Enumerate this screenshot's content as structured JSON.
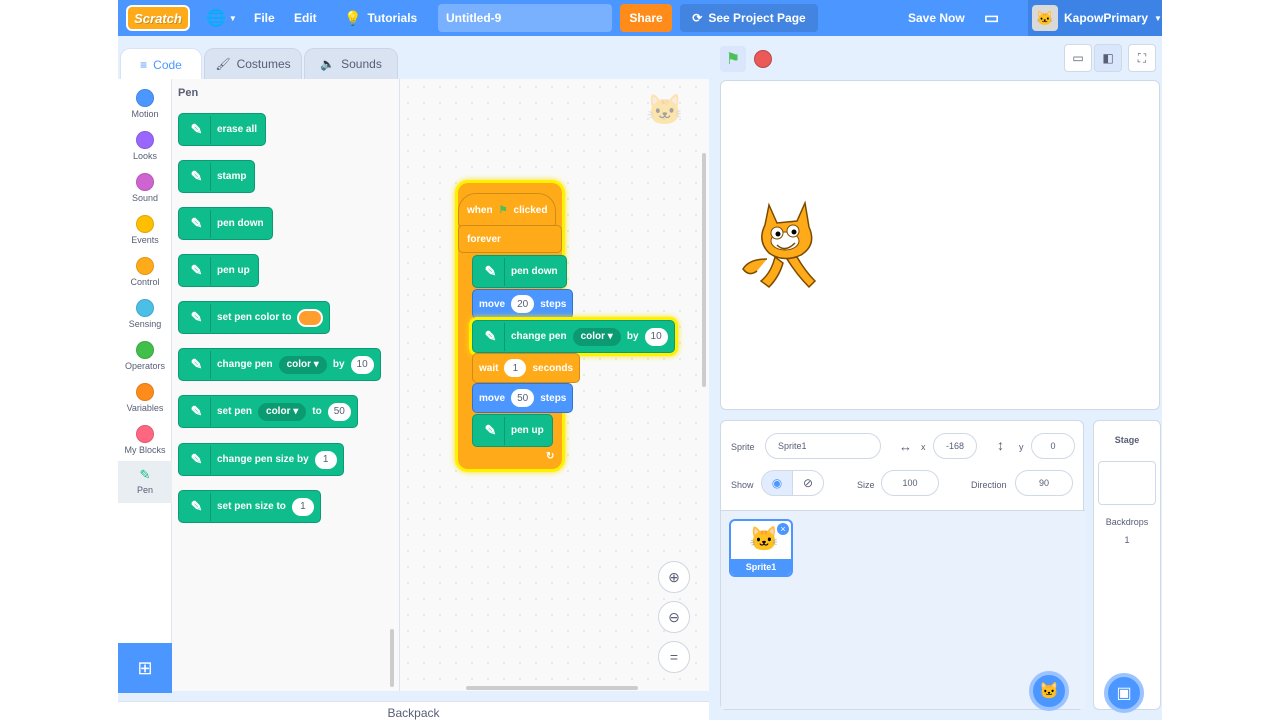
{
  "menu": {
    "logo": "Scratch",
    "globe": "globe-icon",
    "file": "File",
    "edit": "Edit",
    "tutorials": "Tutorials",
    "project_title": "Untitled-9",
    "share": "Share",
    "see_project": "See Project Page",
    "save_now": "Save Now",
    "username": "KapowPrimary"
  },
  "tabs": {
    "code": "Code",
    "costumes": "Costumes",
    "sounds": "Sounds"
  },
  "categories": [
    {
      "label": "Motion",
      "color": "#4c97ff"
    },
    {
      "label": "Looks",
      "color": "#9966ff"
    },
    {
      "label": "Sound",
      "color": "#cf63cf"
    },
    {
      "label": "Events",
      "color": "#ffbf00"
    },
    {
      "label": "Control",
      "color": "#ffab19"
    },
    {
      "label": "Sensing",
      "color": "#4cbfe6"
    },
    {
      "label": "Operators",
      "color": "#40bf4a"
    },
    {
      "label": "Variables",
      "color": "#ff8c1a"
    },
    {
      "label": "My Blocks",
      "color": "#ff6680"
    },
    {
      "label": "Pen",
      "color": "#0fbd8c"
    }
  ],
  "flyout": {
    "title": "Pen",
    "erase_all": "erase all",
    "stamp": "stamp",
    "pen_down": "pen down",
    "pen_up": "pen up",
    "set_pen_color_to": "set pen color to",
    "change_pen": "change pen",
    "color_opt": "color",
    "by": "by",
    "ten": "10",
    "set_pen": "set pen",
    "to": "to",
    "fifty": "50",
    "change_pen_size_by": "change pen size by",
    "one": "1",
    "set_pen_size_to": "set pen size to"
  },
  "script": {
    "when": "when",
    "clicked": "clicked",
    "forever": "forever",
    "pen_down": "pen down",
    "move": "move",
    "move1_val": "20",
    "steps": "steps",
    "change_pen": "change pen",
    "color_opt": "color",
    "by": "by",
    "by_val": "10",
    "wait": "wait",
    "wait_val": "1",
    "seconds": "seconds",
    "move2_val": "50",
    "pen_up": "pen up"
  },
  "backpack": "Backpack",
  "sprite_info": {
    "sprite_label": "Sprite",
    "sprite_name": "Sprite1",
    "x_label": "x",
    "x_val": "-168",
    "y_label": "y",
    "y_val": "0",
    "show_label": "Show",
    "size_label": "Size",
    "size_val": "100",
    "direction_label": "Direction",
    "direction_val": "90"
  },
  "sprite_list": [
    {
      "name": "Sprite1"
    }
  ],
  "stage_pane": {
    "title": "Stage",
    "backdrops_label": "Backdrops",
    "backdrops_count": "1"
  }
}
